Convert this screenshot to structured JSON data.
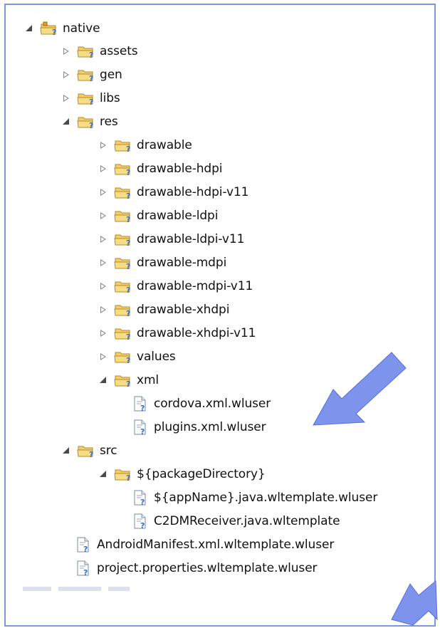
{
  "tree": {
    "root": "native",
    "assets": "assets",
    "gen": "gen",
    "libs": "libs",
    "res": "res",
    "res_children": [
      "drawable",
      "drawable-hdpi",
      "drawable-hdpi-v11",
      "drawable-ldpi",
      "drawable-ldpi-v11",
      "drawable-mdpi",
      "drawable-mdpi-v11",
      "drawable-xhdpi",
      "drawable-xhdpi-v11",
      "values"
    ],
    "xml": "xml",
    "xml_files": [
      "cordova.xml.wluser",
      "plugins.xml.wluser"
    ],
    "src": "src",
    "package_dir": "${packageDirectory}",
    "package_files": [
      "${appName}.java.wltemplate.wluser",
      "C2DMReceiver.java.wltemplate"
    ],
    "root_files": [
      "AndroidManifest.xml.wltemplate.wluser",
      "project.properties.wltemplate.wluser"
    ]
  },
  "colors": {
    "border": "#7a9ae0",
    "arrow_fill": "#7d93ec",
    "folder": "#f2cf6b",
    "badge": "#2f6fd0"
  },
  "icons": {
    "folder": "folder-question-icon",
    "file": "file-question-icon",
    "project": "project-folder-icon",
    "expanded": "expanded-triangle-icon",
    "collapsed": "collapsed-triangle-icon",
    "callout": "callout-arrow-icon"
  }
}
